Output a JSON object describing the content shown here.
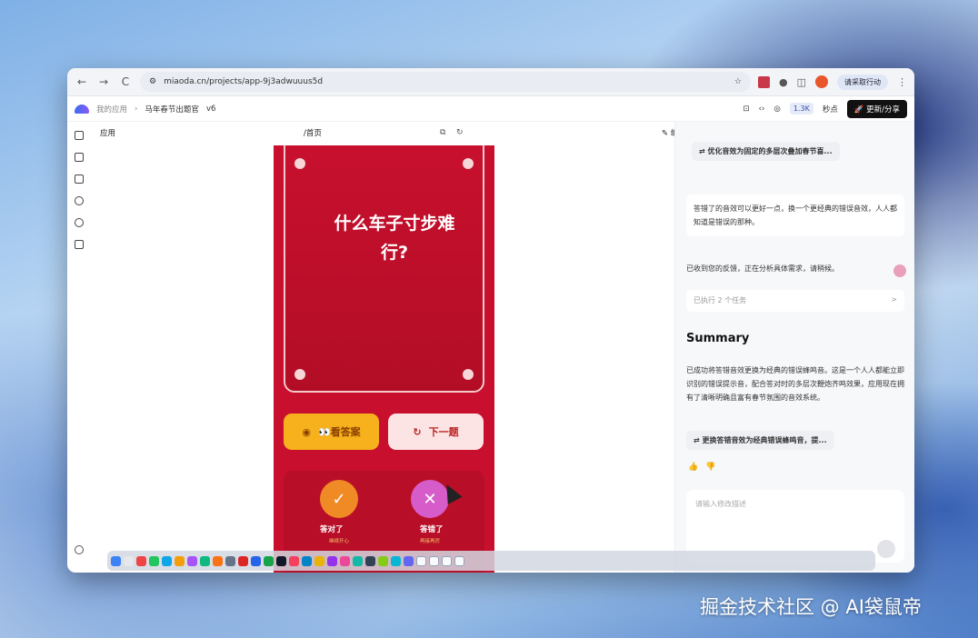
{
  "browser": {
    "url": "miaoda.cn/projects/app-9j3adwuuus5d",
    "cta": "请采取行动",
    "nav": {
      "back": "←",
      "forward": "→",
      "reload": "C"
    }
  },
  "appbar": {
    "breadcrumb_root": "我的应用",
    "project": "马年春节出题官",
    "version": "v6",
    "stat_count": "1.3K",
    "stat_unit": "秒点",
    "publish": "更新/分享"
  },
  "preview": {
    "label": "应用",
    "path": "/首页",
    "edit": "编辑",
    "question": "什么车子寸步难行?",
    "answer_button": "👀看答案",
    "next_button": "下一题",
    "correct_label": "答对了",
    "correct_sub": "继续开心",
    "wrong_label": "答错了",
    "wrong_sub": "再接再厉"
  },
  "chat": {
    "chip1": "优化音效为固定的多层次叠加春节喜...",
    "user_msg": "答错了的音效可以更好一点，换一个更经典的错误音效，人人都知道是错误的那种。",
    "ack": "已收到您的反馈，正在分析具体需求，请稍候。",
    "task": "已执行 2 个任务",
    "task_arrow": ">",
    "summary_title": "Summary",
    "summary_body": "已成功将答错音效更换为经典的错误蜂鸣音。这是一个人人都能立即识别的错误提示音，配合答对时的多层次鞭炮齐鸣效果，应用现在拥有了清晰明确且富有春节氛围的音效系统。",
    "chip2": "更换答错音效为经典错误蜂鸣音，提...",
    "input_placeholder": "请输入修改描述"
  },
  "watermark": "掘金技术社区 @ AI袋鼠帝",
  "colors": {
    "primary_red": "#c8102e",
    "answer_yellow": "#f6b11c",
    "publish_black": "#111111"
  }
}
